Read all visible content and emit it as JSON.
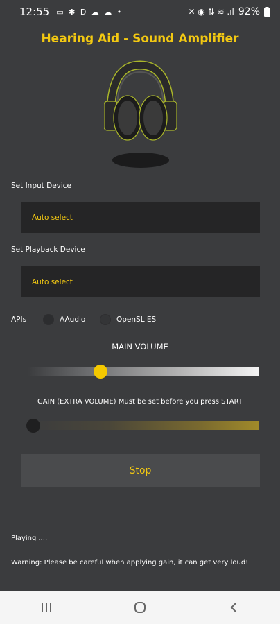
{
  "status_bar": {
    "time": "12:55",
    "notification_icons": "▭ ✱ D ☁ ☁ •",
    "system_icons": "✕ ◉ ⇅ ≋ .ıl",
    "battery": "92%"
  },
  "app": {
    "title": "Hearing Aid - Sound Amplifier",
    "accent_color": "#f2c812"
  },
  "input_device": {
    "label": "Set Input Device",
    "value": "Auto select"
  },
  "playback_device": {
    "label": "Set Playback Device",
    "value": "Auto select"
  },
  "apis": {
    "label": "APIs",
    "options": [
      {
        "label": "AAudio",
        "selected": true
      },
      {
        "label": "OpenSL ES",
        "selected": false
      }
    ]
  },
  "main_volume": {
    "title": "MAIN VOLUME",
    "level": 0.32
  },
  "gain": {
    "title": "GAIN (EXTRA VOLUME) Must be set before you press START",
    "level": 0.0
  },
  "stop_button": {
    "label": "Stop"
  },
  "status": "Playing ....",
  "warning": "Warning: Please be careful when applying gain, it can get very loud!",
  "nav": {
    "recents_icon": "recents-icon",
    "home_icon": "home-icon",
    "back_icon": "back-icon"
  }
}
